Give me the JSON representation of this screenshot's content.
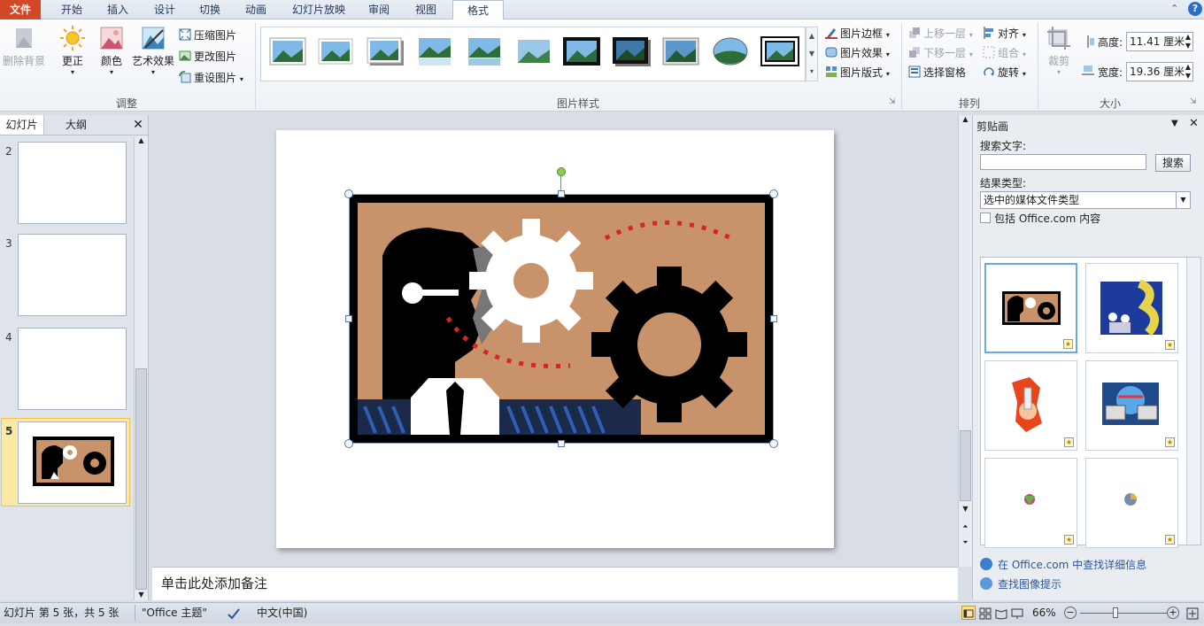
{
  "tabs": [
    {
      "label": "文件"
    },
    {
      "label": "开始"
    },
    {
      "label": "插入"
    },
    {
      "label": "设计"
    },
    {
      "label": "切换"
    },
    {
      "label": "动画"
    },
    {
      "label": "幻灯片放映"
    },
    {
      "label": "审阅"
    },
    {
      "label": "视图"
    },
    {
      "label": "格式"
    }
  ],
  "ribbon": {
    "adjust": {
      "remove_bg": "删除背景",
      "correct": "更正",
      "color": "颜色",
      "art": "艺术效果",
      "compress": "压缩图片",
      "change": "更改图片",
      "reset": "重设图片",
      "group_label": "调整"
    },
    "styles": {
      "border": "图片边框",
      "effects": "图片效果",
      "layout": "图片版式",
      "group_label": "图片样式"
    },
    "arrange": {
      "forward": "上移一层",
      "backward": "下移一层",
      "selection": "选择窗格",
      "align": "对齐",
      "group": "组合",
      "rotate": "旋转",
      "group_label": "排列"
    },
    "size": {
      "crop": "裁剪",
      "height_label": "高度:",
      "height_value": "11.41 厘米",
      "width_label": "宽度:",
      "width_value": "19.36 厘米",
      "group_label": "大小"
    }
  },
  "left_pane": {
    "tab_slides": "幻灯片",
    "tab_outline": "大纲",
    "close": "✕",
    "slides": [
      {
        "num": "2"
      },
      {
        "num": "3"
      },
      {
        "num": "4"
      },
      {
        "num": "5"
      }
    ]
  },
  "notes": {
    "placeholder": "单击此处添加备注"
  },
  "clipart": {
    "title": "剪贴画",
    "search_label": "搜索文字:",
    "search_value": "",
    "search_btn": "搜索",
    "result_label": "结果类型:",
    "result_value": "选中的媒体文件类型",
    "include_label": "包括 Office.com 内容",
    "link1": "在 Office.com 中查找详细信息",
    "link2": "查找图像提示"
  },
  "status": {
    "slide_info": "幻灯片 第 5 张，共 5 张",
    "theme": "\"Office 主题\"",
    "language": "中文(中国)",
    "zoom": "66%",
    "zoom_level": 0.4
  },
  "colors": {
    "file_tab": "#d24726",
    "accent": "#2b579a",
    "selection": "#f5c342"
  }
}
